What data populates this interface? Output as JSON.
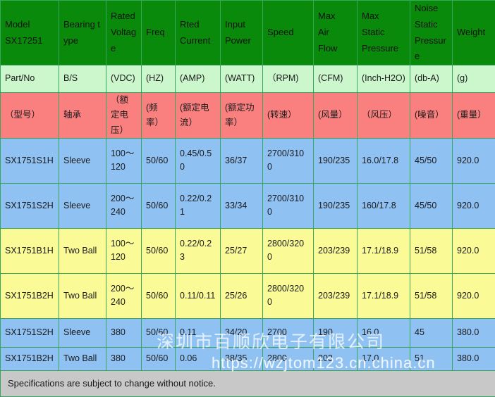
{
  "table": {
    "columns": [
      {
        "key": "model",
        "header_en": "Model\nSX17251",
        "header_unit": "Part/No",
        "header_cn": "（型号）"
      },
      {
        "key": "bearing",
        "header_en": "Bearing type",
        "header_unit": "B/S",
        "header_cn": "轴承"
      },
      {
        "key": "voltage",
        "header_en": "Rated Voltage",
        "header_unit": "(VDC)",
        "header_cn": "（额定电压）"
      },
      {
        "key": "freq",
        "header_en": "Freq",
        "header_unit": "(HZ)",
        "header_cn": "(频率）"
      },
      {
        "key": "current",
        "header_en": "Rted Current",
        "header_unit": "(AMP)",
        "header_cn": "(额定电流）"
      },
      {
        "key": "power",
        "header_en": "Input Power",
        "header_unit": "(WATT)",
        "header_cn": "(额定功率）"
      },
      {
        "key": "speed",
        "header_en": "Speed",
        "header_unit": "（RPM)",
        "header_cn": "(转速）"
      },
      {
        "key": "airflow",
        "header_en": "Max Air Flow",
        "header_unit": "(CFM)",
        "header_cn": "(风量）"
      },
      {
        "key": "pressure",
        "header_en": "Max Static Pressure",
        "header_unit": "(Inch-H2O)",
        "header_cn": "（风压）"
      },
      {
        "key": "noise",
        "header_en": "Noise Static Pressure",
        "header_unit": "(db-A)",
        "header_cn": "(噪音）"
      },
      {
        "key": "weight",
        "header_en": "Weight",
        "header_unit": "(g)",
        "header_cn": "(重量）"
      }
    ],
    "header_row": {
      "model": "Model\nSX17251",
      "bearing_line1": "Bearing t",
      "bearing_line2": "ype",
      "voltage_line1": "Rated",
      "voltage_line2": "Voltag",
      "voltage_line3": "e",
      "freq": "Freq",
      "current_line1": "Rted",
      "current_line2": "Current",
      "power_line1": "Input",
      "power_line2": "Power",
      "speed": "Speed",
      "airflow_line1": "Max",
      "airflow_line2": "Air",
      "airflow_line3": "Flow",
      "pressure_line1": "Max",
      "pressure_line2": "Static",
      "pressure_line3": "Pressure",
      "noise_line1": "Noise",
      "noise_line2": "Static",
      "noise_line3": "Pressure",
      "weight": "Weight",
      "model_line1": "Model",
      "model_line2": "SX17251"
    },
    "unit_row": [
      "Part/No",
      "B/S",
      "(VDC)",
      "(HZ)",
      "(AMP)",
      "(WATT)",
      "（RPM)",
      "(CFM)",
      "(Inch-H2O)",
      "(db-A)",
      "(g)"
    ],
    "cn_row": [
      "（型号）",
      "轴承",
      "（额定电压）",
      "(频率）",
      "(额定电流）",
      "(额定功率）",
      "(转速）",
      "(风量）",
      "（风压）",
      "(噪音）",
      "(重量）"
    ],
    "rows": [
      {
        "band": "blue",
        "height": "tall",
        "cells": [
          "SX1751S1H",
          "Sleeve",
          "100～120",
          "50/60",
          "0.45/0.50",
          "36/37",
          "2700/3100",
          "190/235",
          "16.0/17.8",
          "45/50",
          "920.0"
        ]
      },
      {
        "band": "blue",
        "height": "tall",
        "cells": [
          "SX1751S2H",
          "Sleeve",
          "200～240",
          "50/60",
          "0.22/0.21",
          "33/34",
          "2700/3100",
          "190/235",
          "160/17.8",
          "45/50",
          "920.0"
        ]
      },
      {
        "band": "yellow",
        "height": "tall",
        "cells": [
          "SX1751B1H",
          "Two Ball",
          "100～120",
          "50/60",
          "0.22/0.23",
          "25/27",
          "2800/3200",
          "203/239",
          "17.1/18.9",
          "51/58",
          "920.0"
        ]
      },
      {
        "band": "yellow",
        "height": "tall",
        "cells": [
          "SX1751B2H",
          "Two Ball",
          "200～240",
          "50/60",
          "0.11/0.11",
          "25/26",
          "2800/3200",
          "203/239",
          "17.1/18.9",
          "51/58",
          "920.0"
        ]
      },
      {
        "band": "blue",
        "height": "short",
        "cells": [
          "SX1751S2H",
          "Sleeve",
          "380",
          "50/60",
          "0.11",
          "34/20",
          "2700",
          "190",
          "16.0",
          "45",
          "380.0"
        ]
      },
      {
        "band": "blue",
        "height": "short2",
        "cells": [
          "SX1751B2H",
          "Two Ball",
          "380",
          "50/60",
          "0.06",
          "38/35",
          "2800",
          "203",
          "17.0",
          "51",
          "380.0"
        ]
      }
    ],
    "footer_note": "Specifications are subject to change without notice."
  },
  "watermarks": {
    "company_cn": "深圳市百顺欣电子有限公司",
    "url": "https://wzjtom123.cn.china.cn"
  },
  "colors": {
    "header_green": "#0a8a0a",
    "unit_green": "#ccf6cc",
    "cn_red": "#fa8080",
    "row_blue": "#8fc1f3",
    "row_yellow": "#fafa96",
    "footer_gray": "#c8c8c8",
    "border_green": "#35a85f"
  }
}
